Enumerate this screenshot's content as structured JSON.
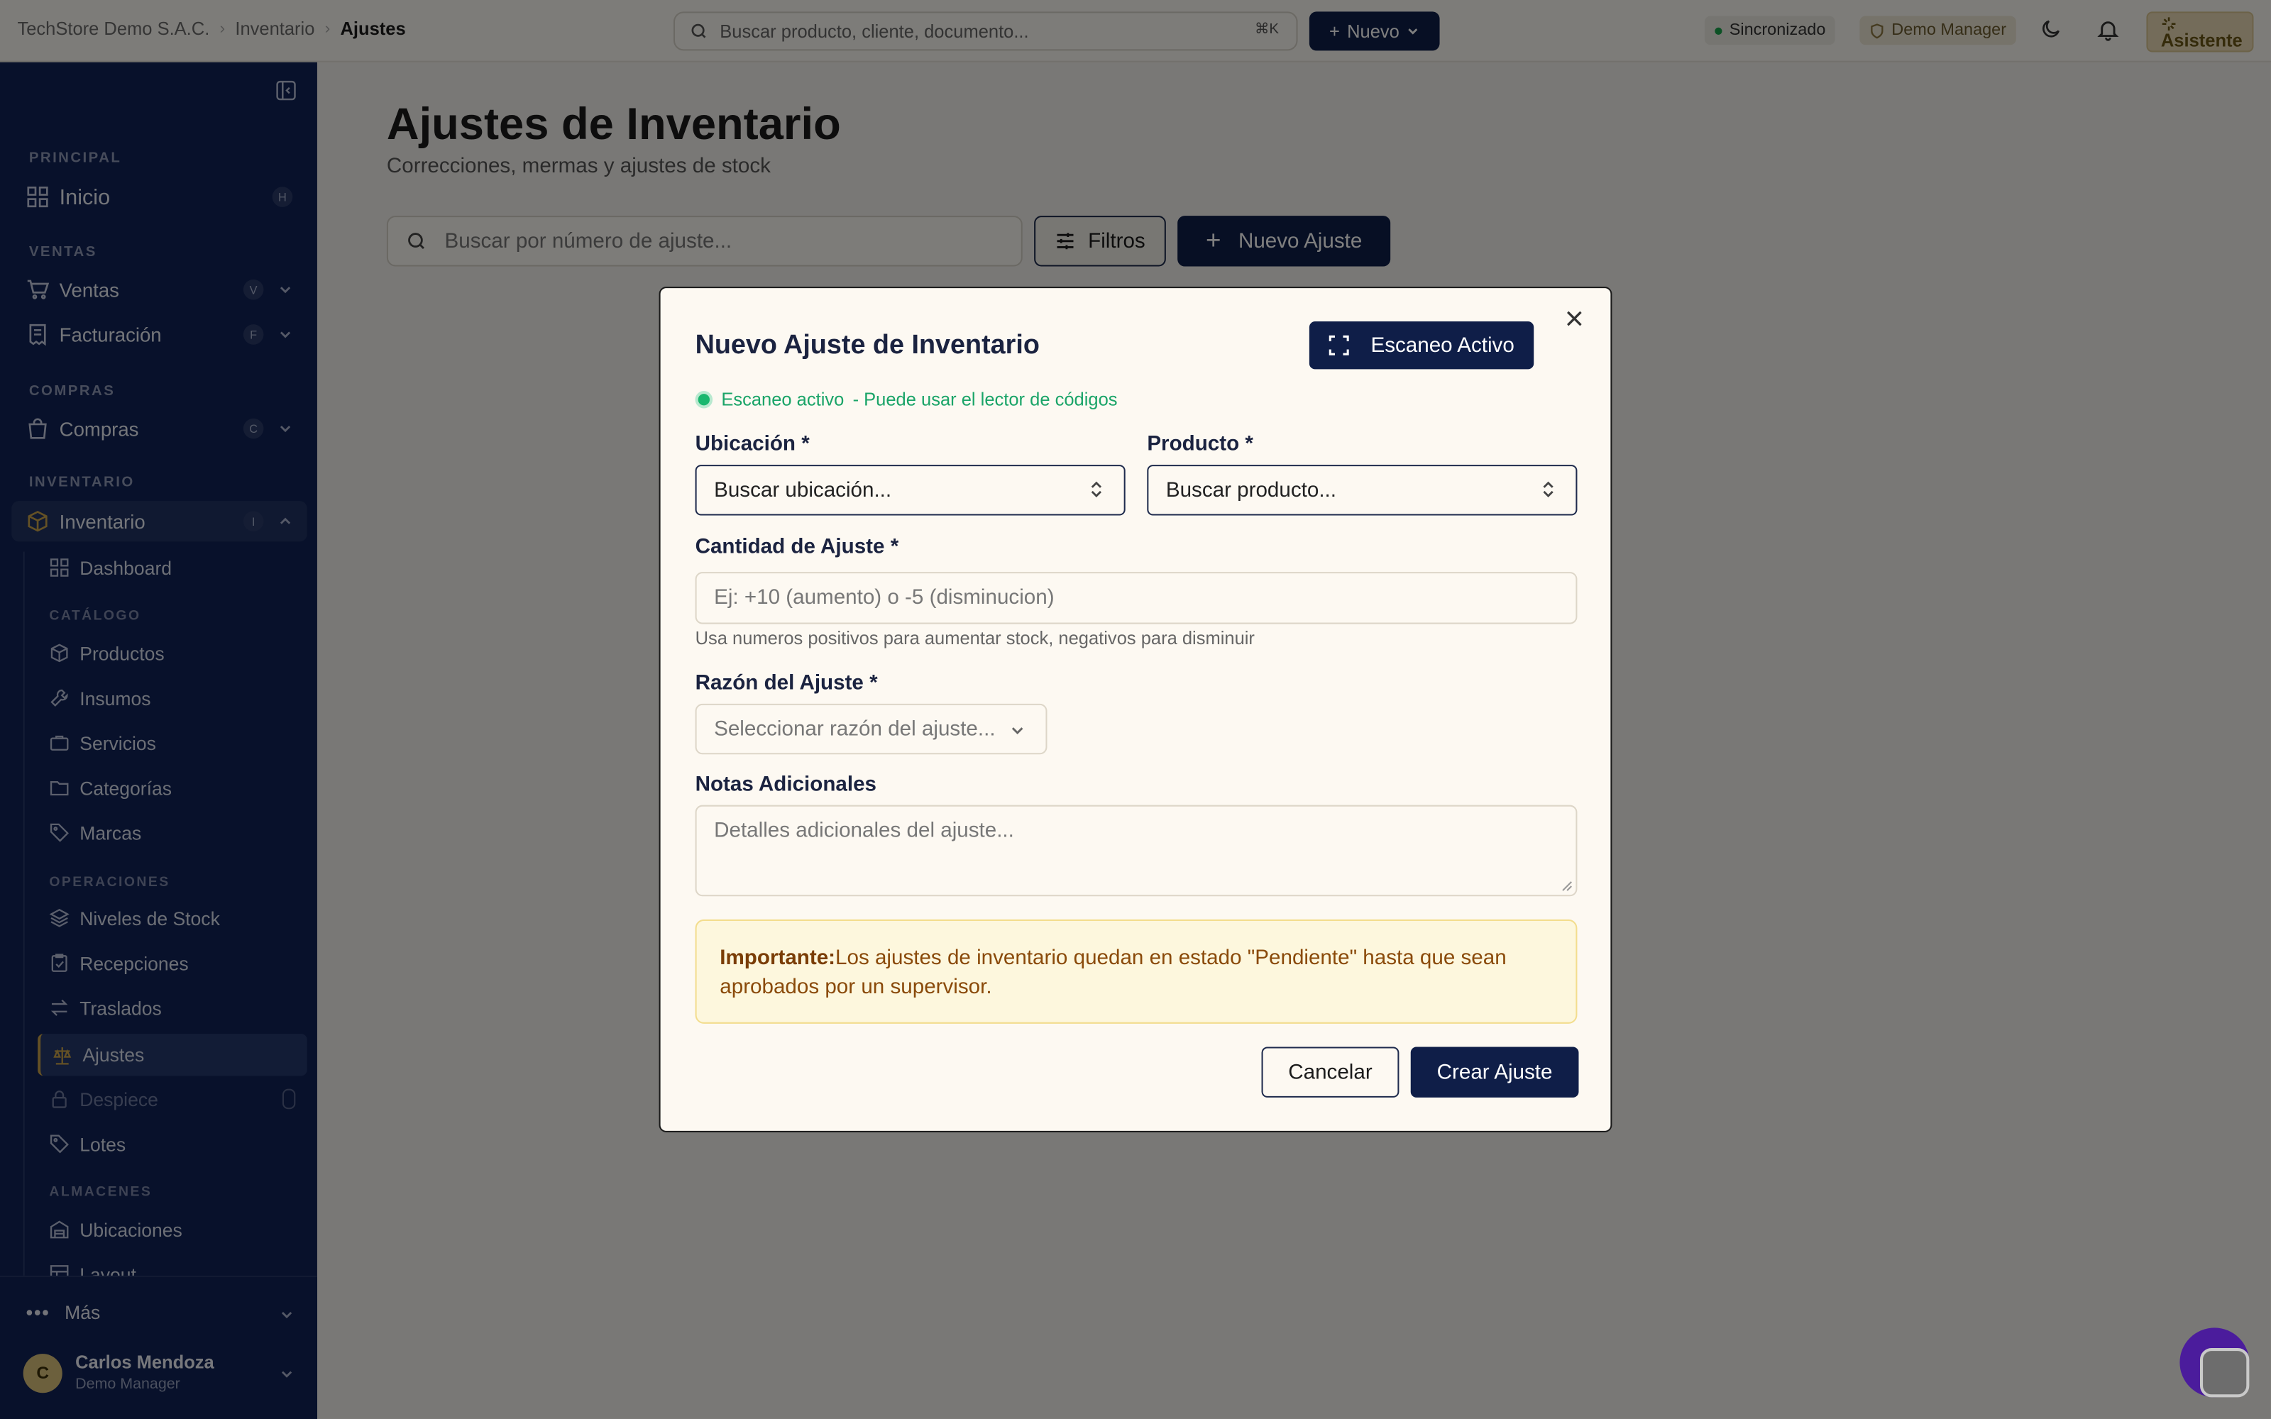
{
  "breadcrumb": {
    "org": "TechStore Demo S.A.C.",
    "section": "Inventario",
    "current": "Ajustes"
  },
  "topbar": {
    "search_placeholder": "Buscar producto, cliente, documento...",
    "search_shortcut": "⌘K",
    "new_label": "Nuevo",
    "sync_label": "Sincronizado",
    "role_chip": "Demo Manager",
    "assistant_label": "Asistente"
  },
  "sidebar": {
    "sections": {
      "principal": "PRINCIPAL",
      "ventas": "VENTAS",
      "compras": "COMPRAS",
      "inventario": "INVENTARIO"
    },
    "items": {
      "inicio": {
        "label": "Inicio",
        "key": "H"
      },
      "ventas": {
        "label": "Ventas",
        "key": "V"
      },
      "facturacion": {
        "label": "Facturación",
        "key": "F"
      },
      "compras": {
        "label": "Compras",
        "key": "C"
      },
      "inventario": {
        "label": "Inventario",
        "key": "I"
      }
    },
    "subsections": {
      "catalogo": "CATÁLOGO",
      "operaciones": "OPERACIONES",
      "almacenes": "ALMACENES"
    },
    "sub": {
      "dashboard": "Dashboard",
      "productos": "Productos",
      "insumos": "Insumos",
      "servicios": "Servicios",
      "categorias": "Categorías",
      "marcas": "Marcas",
      "niveles": "Niveles de Stock",
      "recepciones": "Recepciones",
      "traslados": "Traslados",
      "ajustes": "Ajustes",
      "despiece": "Despiece",
      "lotes": "Lotes",
      "ubicaciones": "Ubicaciones",
      "layout": "Layout"
    },
    "more_label": "Más",
    "user": {
      "initial": "C",
      "name": "Carlos Mendoza",
      "role": "Demo Manager"
    }
  },
  "page": {
    "title": "Ajustes de Inventario",
    "subtitle": "Correcciones, mermas y ajustes de stock",
    "search_placeholder": "Buscar por número de ajuste...",
    "filters_label": "Filtros",
    "new_adjustment_label": "Nuevo Ajuste"
  },
  "modal": {
    "title": "Nuevo Ajuste de Inventario",
    "scan_button": "Escaneo Activo",
    "scan_status": "Escaneo activo",
    "scan_status_detail": "- Puede usar el lector de códigos",
    "location_label": "Ubicación *",
    "location_placeholder": "Buscar ubicación...",
    "product_label": "Producto *",
    "product_placeholder": "Buscar producto...",
    "quantity_label": "Cantidad de Ajuste *",
    "quantity_placeholder": "Ej: +10 (aumento) o -5 (disminucion)",
    "quantity_hint": "Usa numeros positivos para aumentar stock, negativos para disminuir",
    "reason_label": "Razón del Ajuste *",
    "reason_placeholder": "Seleccionar razón del ajuste...",
    "notes_label": "Notas Adicionales",
    "notes_placeholder": "Detalles adicionales del ajuste...",
    "warning_bold": "Importante:",
    "warning_text": "Los ajustes de inventario quedan en estado \"Pendiente\" hasta que sean aprobados por un supervisor.",
    "cancel_label": "Cancelar",
    "create_label": "Crear Ajuste"
  },
  "colors": {
    "primary": "#0f1e48",
    "sidebar_bg": "#102256",
    "success": "#1ab76e",
    "warning_bg": "#fdf7dd",
    "warning_text": "#8a4a0a"
  }
}
